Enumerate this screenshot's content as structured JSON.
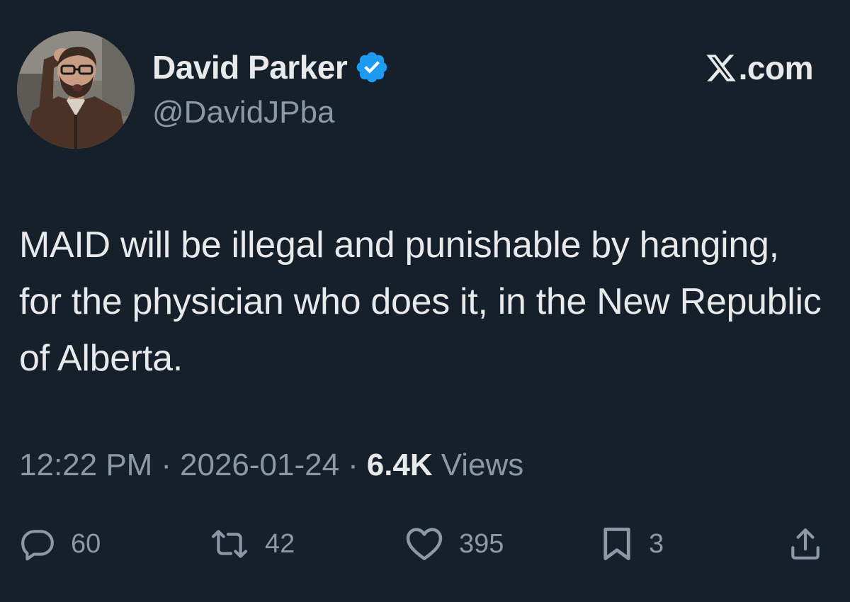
{
  "author": {
    "display_name": "David Parker",
    "handle": "@DavidJPba",
    "verified": true,
    "avatar": "avatar-photo"
  },
  "brand": {
    "label": ".com",
    "icon": "x-logo-icon"
  },
  "tweet": {
    "text": "MAID will be illegal and punishable by hanging, for the physician who does it, in the New Republic of Alberta."
  },
  "meta": {
    "time": "12:22 PM",
    "separator": "·",
    "date": "2026-01-24",
    "views_count": "6.4K",
    "views_label": "Views"
  },
  "actions": {
    "reply": {
      "icon": "reply-icon",
      "count": "60"
    },
    "repost": {
      "icon": "repost-icon",
      "count": "42"
    },
    "like": {
      "icon": "heart-icon",
      "count": "395"
    },
    "bookmark": {
      "icon": "bookmark-icon",
      "count": "3"
    },
    "share": {
      "icon": "share-icon"
    }
  },
  "colors": {
    "background": "#15202b",
    "primary_text": "#e7e9ea",
    "secondary_text": "#8b98a5",
    "verified_blue": "#1d9bf0"
  }
}
